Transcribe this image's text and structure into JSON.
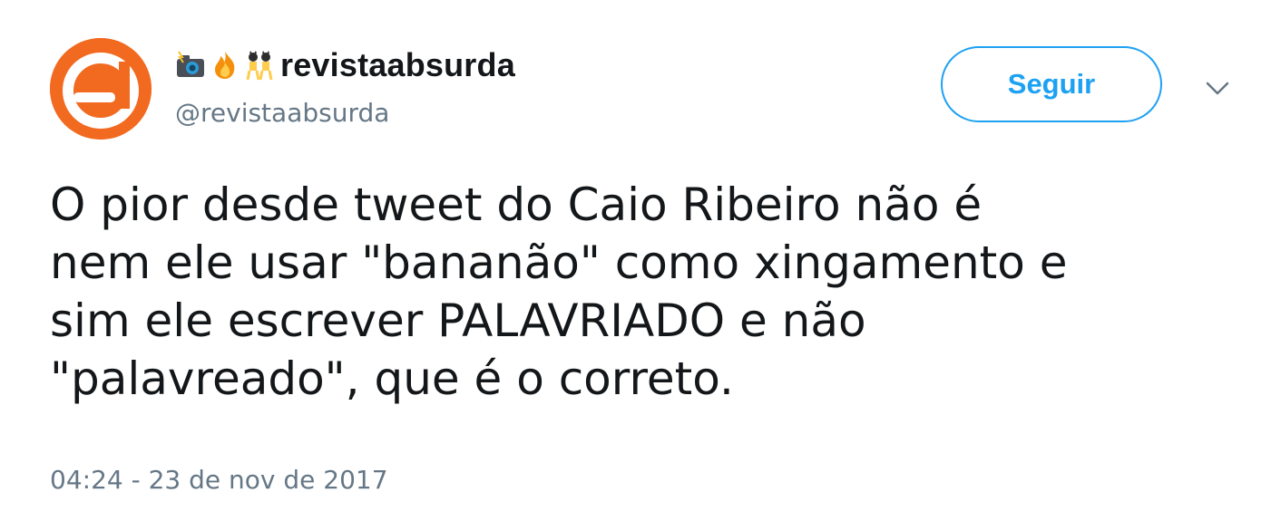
{
  "tweet": {
    "display_name": "revistaabsurda",
    "name_emojis": [
      "camera-with-flash-icon",
      "fire-icon",
      "dancers-icon"
    ],
    "handle": "@revistaabsurda",
    "follow_label": "Seguir",
    "text": "O pior desde tweet do Caio Ribeiro não é\nnem ele usar \"bananão\" como xingamento e\nsim ele escrever PALAVRIADO e não\n\"palavreado\", que é o correto.",
    "timestamp": "04:24 - 23 de nov de 2017"
  },
  "colors": {
    "accent": "#1da1f2",
    "avatar_bg": "#f26a1f",
    "secondary_text": "#657786",
    "primary_text": "#14171a"
  }
}
